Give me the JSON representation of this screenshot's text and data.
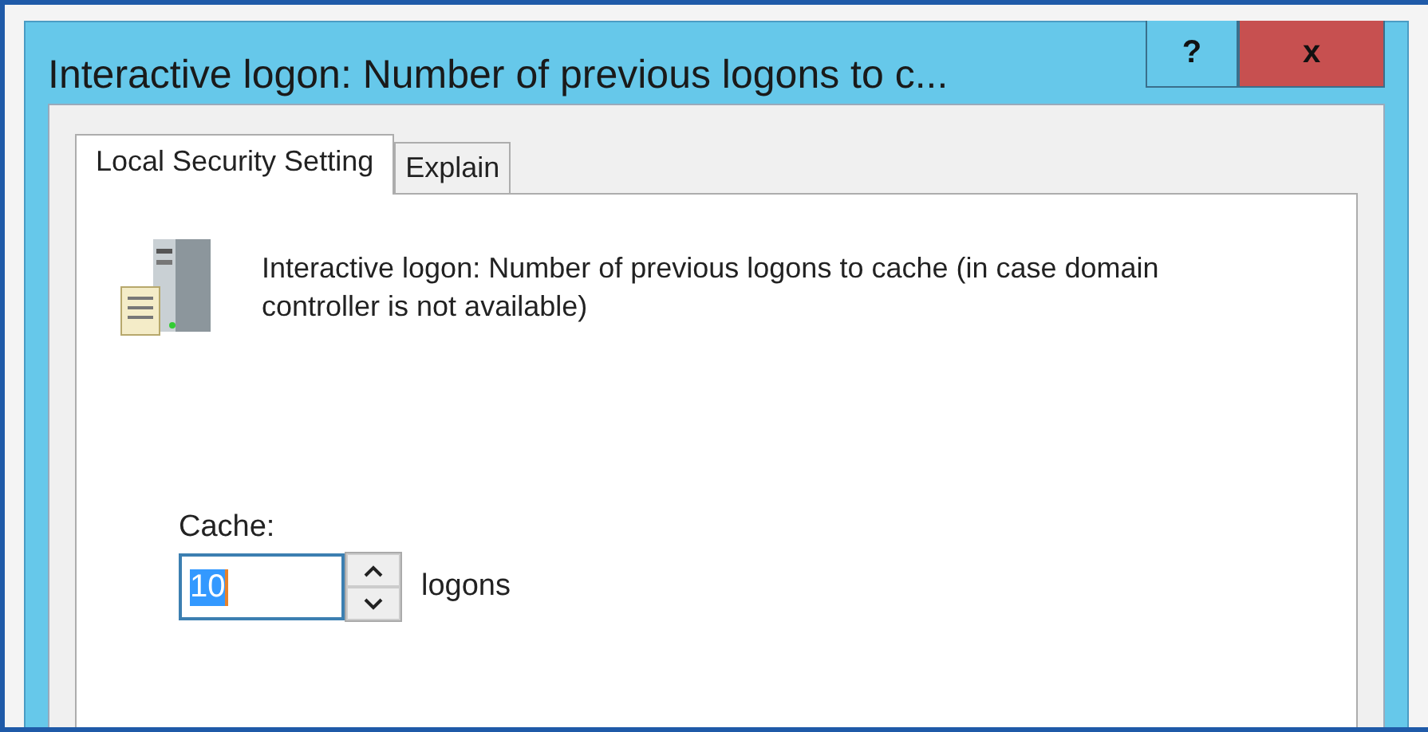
{
  "window": {
    "title": "Interactive logon: Number of previous logons to c..."
  },
  "title_buttons": [
    {
      "kind": "help",
      "label": "?"
    },
    {
      "kind": "close",
      "label": "x"
    }
  ],
  "tabs": [
    {
      "label": "Local Security Setting",
      "selected": true
    },
    {
      "label": "Explain",
      "selected": false
    }
  ],
  "description": "Interactive logon: Number of previous logons to cache (in case domain controller is not available)",
  "cache": {
    "label": "Cache:",
    "value": "10",
    "value_selected": true,
    "unit": "logons"
  }
}
